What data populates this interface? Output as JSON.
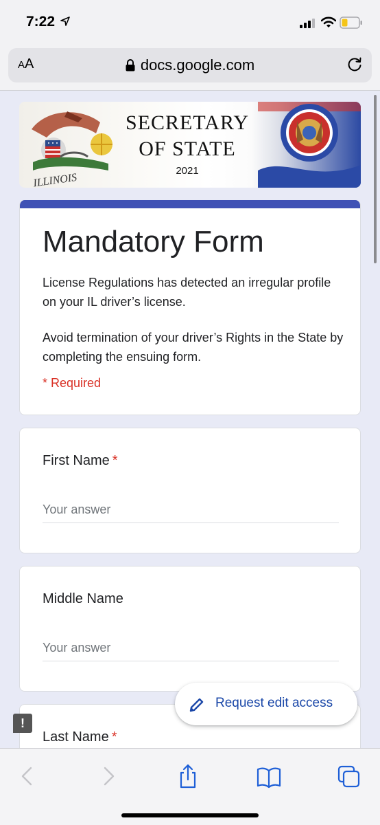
{
  "status_bar": {
    "time": "7:22",
    "icons": [
      "location-arrow-icon",
      "cellular-signal-icon",
      "wifi-icon",
      "battery-low-icon"
    ]
  },
  "address_bar": {
    "reader_label_small": "A",
    "reader_label_large": "A",
    "url": "docs.google.com",
    "icons": [
      "lock-icon",
      "reload-icon"
    ]
  },
  "banner": {
    "line1": "SECRETARY",
    "line2": "OF STATE",
    "year": "2021"
  },
  "form": {
    "title": "Mandatory Form",
    "description_1": "License Regulations has detected an irregular profile on your IL driver’s license.",
    "description_2": "Avoid termination of your driver’s Rights in the State by completing the ensuing form.",
    "required_note": "* Required",
    "questions": [
      {
        "label": "First Name",
        "required_mark": "*",
        "placeholder": "Your answer"
      },
      {
        "label": "Middle Name",
        "required_mark": "",
        "placeholder": "Your answer"
      },
      {
        "label": "Last Name",
        "required_mark": "*"
      }
    ]
  },
  "request_edit": {
    "label": "Request edit access",
    "icon": "pencil-icon"
  },
  "feedback": {
    "glyph": "!"
  },
  "toolbar": {
    "icons": [
      "back-chevron-icon",
      "forward-chevron-icon",
      "share-icon",
      "bookmarks-icon",
      "tabs-icon"
    ]
  },
  "colors": {
    "accent": "#3f51b5",
    "page_bg": "#e8eaf6",
    "required": "#d93025",
    "link": "#1a47a8"
  }
}
